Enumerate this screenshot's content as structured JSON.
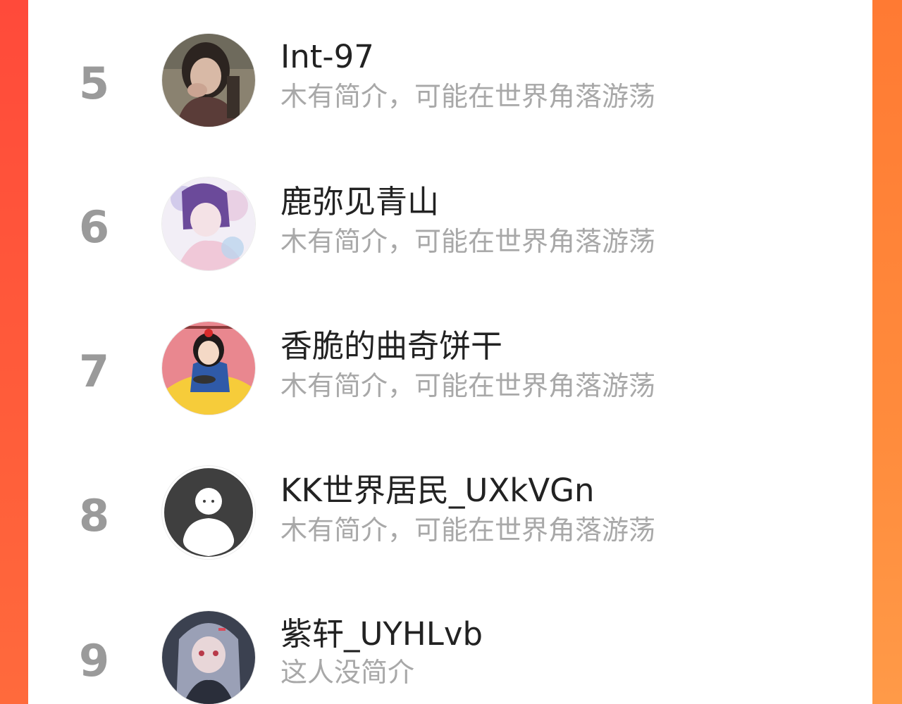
{
  "theme": {
    "accent_left": "#ff4a3a",
    "accent_right": "#ff8b3c",
    "rank_color": "#9a9a9a",
    "name_color": "#222222",
    "bio_color": "#a8a8a8"
  },
  "leaderboard": {
    "entries": [
      {
        "rank": "5",
        "name": "Int-97",
        "bio": "木有简介，可能在世界角落游荡",
        "avatar": "photo-avatar"
      },
      {
        "rank": "6",
        "name": "鹿弥见青山",
        "bio": "木有简介，可能在世界角落游荡",
        "avatar": "anime-avatar"
      },
      {
        "rank": "7",
        "name": "香脆的曲奇饼干",
        "bio": "木有简介，可能在世界角落游荡",
        "avatar": "snow-white-avatar"
      },
      {
        "rank": "8",
        "name": "KK世界居民_UXkVGn",
        "bio": "木有简介，可能在世界角落游荡",
        "avatar": "default-avatar"
      },
      {
        "rank": "9",
        "name": "紫轩_UYHLvb",
        "bio": "这人没简介",
        "avatar": "anime-girl-avatar"
      }
    ]
  }
}
